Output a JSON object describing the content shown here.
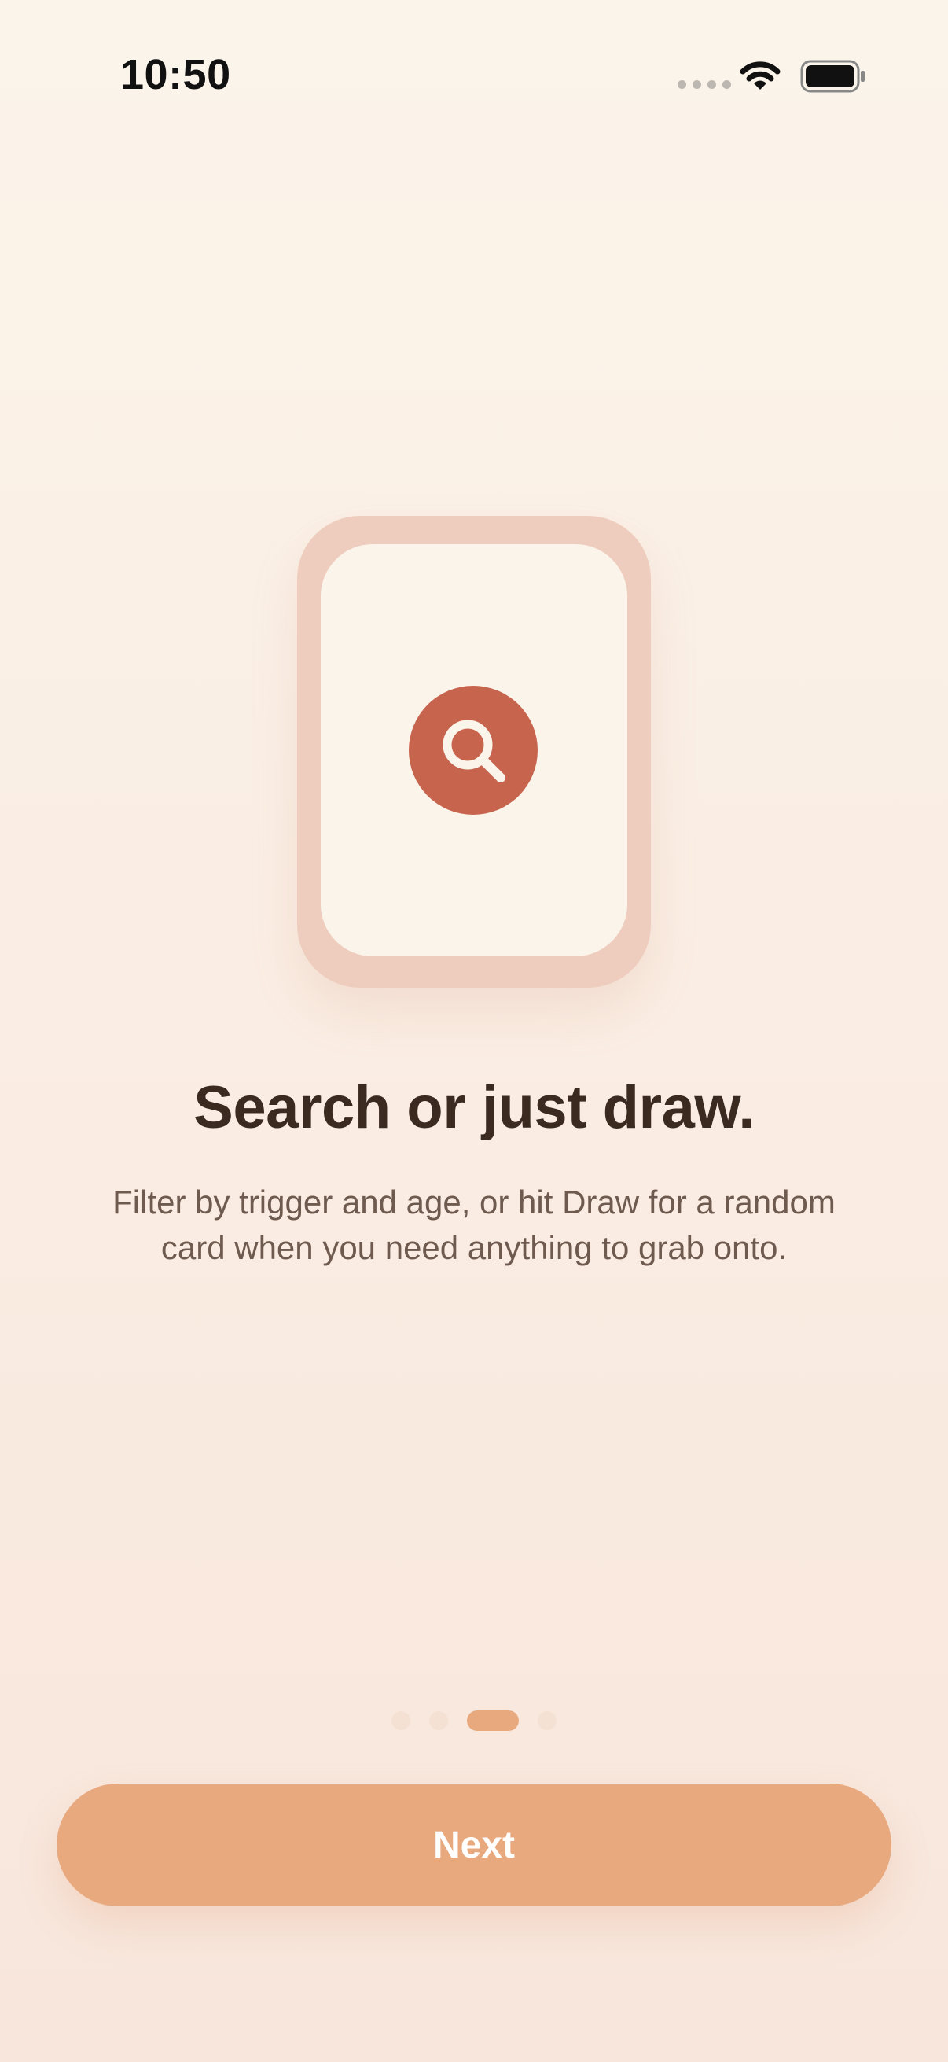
{
  "status_bar": {
    "time": "10:50"
  },
  "onboarding": {
    "icon": "search-icon",
    "title": "Search or just draw.",
    "description": "Filter by trigger and age, or hit Draw for a random card when you need anything to grab onto.",
    "pages_total": 4,
    "current_page": 3
  },
  "actions": {
    "next_label": "Next"
  },
  "colors": {
    "accent": "#E9A97E",
    "icon_badge": "#C6644E",
    "card_frame": "#EFCDBE",
    "card_face": "#FBF4EA",
    "title_text": "#3A2A20",
    "body_text": "#6E5A4E"
  }
}
